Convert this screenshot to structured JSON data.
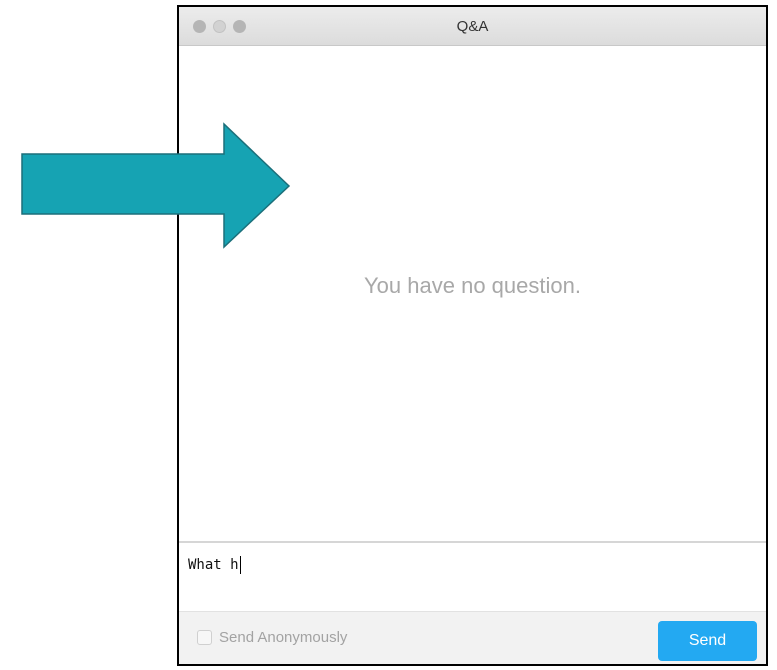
{
  "window": {
    "title": "Q&A"
  },
  "content": {
    "empty_message": "You have no question."
  },
  "compose": {
    "input_value": "What h"
  },
  "footer": {
    "anonymous_label": "Send Anonymously",
    "anonymous_checked": false,
    "send_label": "Send"
  },
  "colors": {
    "accent": "#23a9f2",
    "arrow": "#16a3b3"
  },
  "icons": {
    "traffic_lights": [
      "close-dot",
      "minimize-dot",
      "zoom-dot"
    ],
    "annotation": "right-arrow-icon"
  }
}
